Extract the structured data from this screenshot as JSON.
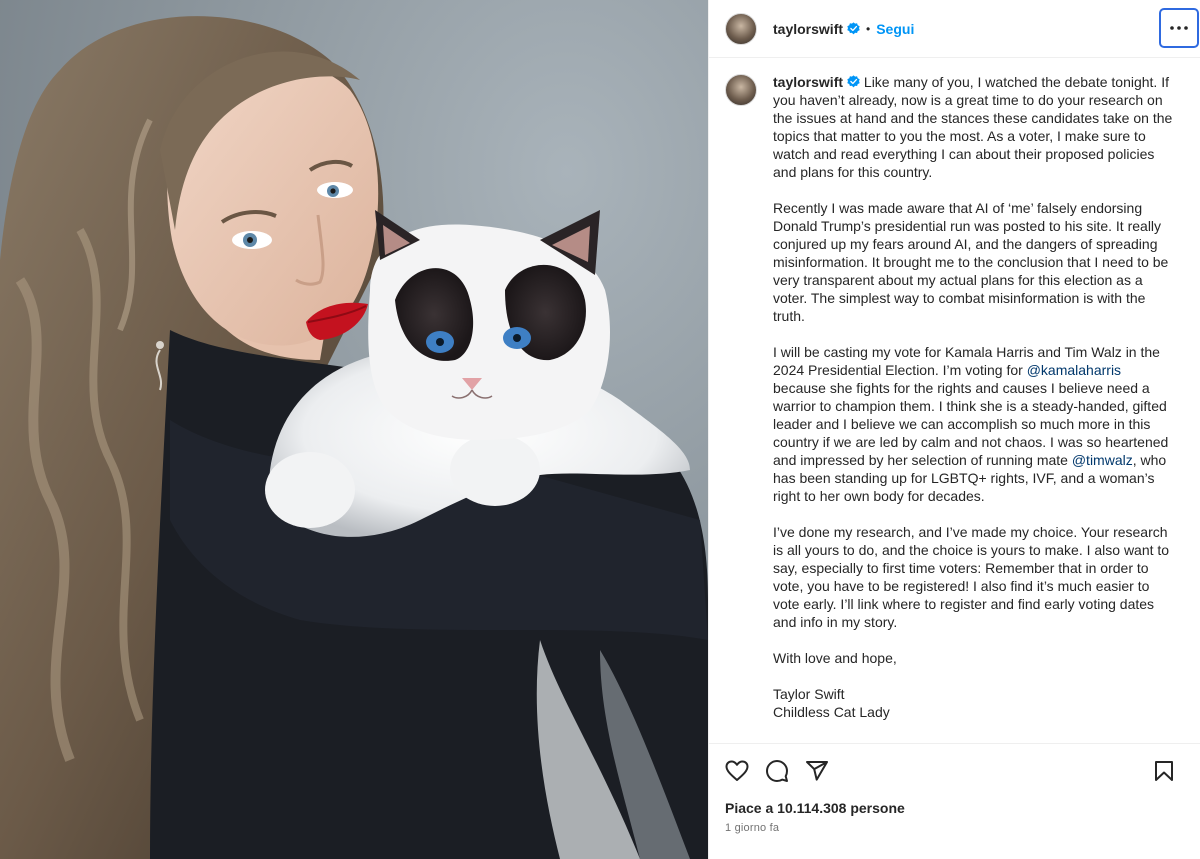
{
  "post": {
    "image_alt": "Portrait of a woman with long wavy hair and red lipstick holding a ragdoll cat"
  },
  "header": {
    "username": "taylorswift",
    "separator": "•",
    "follow_label": "Segui",
    "more_icon": "more-horizontal-icon"
  },
  "caption": {
    "username": "taylorswift",
    "p1": "Like many of you, I watched the debate tonight. If you haven’t already, now is a great time to do your research on the issues at hand and the stances these candidates take on the topics that matter to you the most. As a voter, I make sure to watch and read everything I can about their proposed policies and plans for this country.",
    "p2": "Recently I was made aware that AI of ‘me’ falsely endorsing Donald Trump’s presidential run was posted to his site. It really conjured up my fears around AI, and the dangers of spreading misinformation. It brought me to the conclusion that I need to be very transparent about my actual plans for this election as a voter. The simplest way to combat misinformation is with the truth.",
    "p3_a": "I will be casting my vote for Kamala Harris and Tim Walz in the 2024 Presidential Election. I’m voting for ",
    "p3_mention1": "@kamalaharris",
    "p3_b": " because she fights for the rights and causes I believe need a warrior to champion them. I think she is a steady-handed, gifted leader and I believe we can accomplish so much more in this country if we are led by calm and not chaos. I was so heartened and impressed by her selection of running mate ",
    "p3_mention2": "@timwalz",
    "p3_c": ", who has been standing up for LGBTQ+ rights, IVF, and a woman’s right to her own body for decades.",
    "p4": "I’ve done my research, and I’ve made my choice. Your research is all yours to do, and the choice is yours to make. I also want to say, especially to first time voters: Remember that in order to vote, you have to be registered! I also find it’s much easier to vote early. I’ll link where to register and find early voting dates and info in my story.",
    "p5": "With love and hope,",
    "sig1": "Taylor Swift",
    "sig2": "Childless Cat Lady"
  },
  "actions": {
    "icons": [
      "heart-icon",
      "comment-icon",
      "share-icon",
      "bookmark-icon"
    ],
    "likes_text": "Piace a 10.114.308 persone",
    "time_text": "1 giorno fa"
  },
  "colors": {
    "link_blue": "#0095f6",
    "mention": "#00376b",
    "verified": "#0095f6",
    "focus_ring": "#2f6ae0"
  }
}
